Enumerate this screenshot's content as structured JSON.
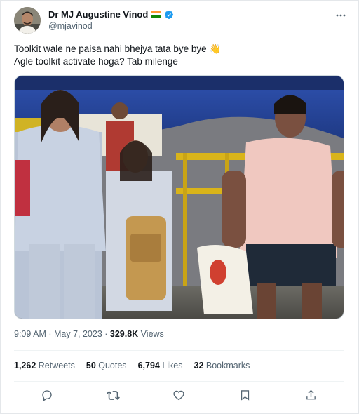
{
  "author": {
    "display_name": "Dr MJ Augustine Vinod",
    "handle": "@mjavinod",
    "flag_icon": "india-flag-icon",
    "verified_icon": "verified-badge-icon",
    "verified_color": "#1d9bf0"
  },
  "tweet": {
    "line1": "Toolkit wale ne paisa nahi bhejya tata bye bye",
    "line1_emoji": "👋",
    "line2": "Agle toolkit activate hoga? Tab milenge"
  },
  "meta": {
    "time": "9:09 AM",
    "separator1": " · ",
    "date": "May 7, 2023",
    "separator2": " · ",
    "views_count": "329.8K",
    "views_label": " Views"
  },
  "stats": {
    "retweets_count": "1,262",
    "retweets_label": " Retweets",
    "quotes_count": "50",
    "quotes_label": " Quotes",
    "likes_count": "6,794",
    "likes_label": " Likes",
    "bookmarks_count": "32",
    "bookmarks_label": " Bookmarks"
  },
  "actions": [
    "reply-icon",
    "retweet-icon",
    "like-icon",
    "bookmark-icon",
    "share-icon"
  ],
  "colors": {
    "text_primary": "#0f1419",
    "text_secondary": "#536471",
    "divider": "#eff3f4"
  }
}
